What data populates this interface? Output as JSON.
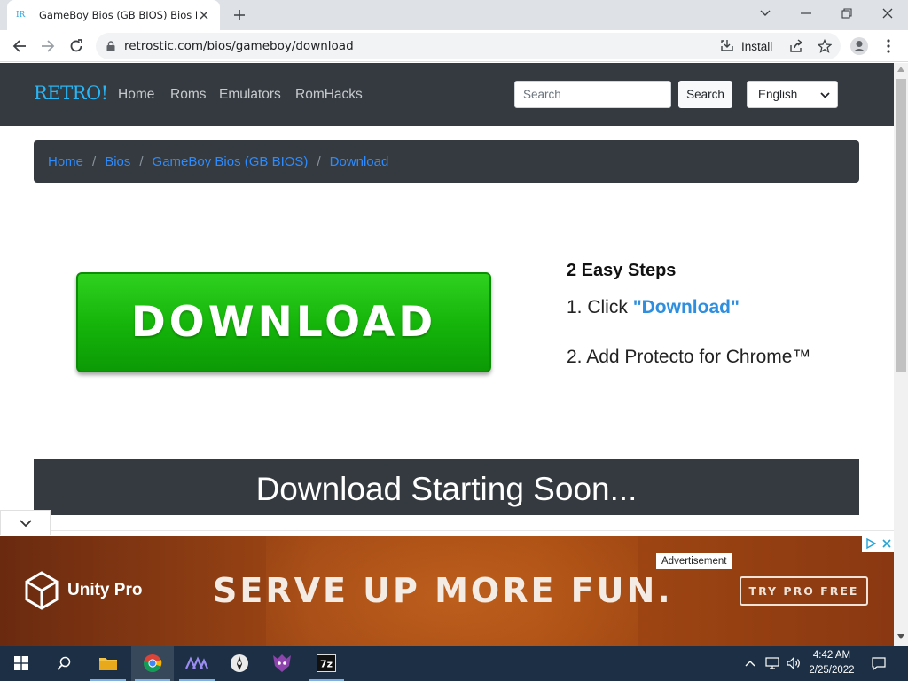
{
  "browser": {
    "tab_title": "GameBoy Bios (GB BIOS) Bios Do",
    "url": "retrostic.com/bios/gameboy/download",
    "install_label": "Install"
  },
  "site": {
    "brand": "RETRO!",
    "nav": [
      "Home",
      "Roms",
      "Emulators",
      "RomHacks"
    ],
    "search_placeholder": "Search",
    "search_button": "Search",
    "language": "English"
  },
  "breadcrumb": {
    "items": [
      "Home",
      "Bios",
      "GameBoy Bios (GB BIOS)",
      "Download"
    ],
    "separator": "/"
  },
  "download": {
    "button_label": "DOWNLOAD",
    "steps_title": "2 Easy Steps",
    "step1_prefix": "1. Click ",
    "step1_link": "\"Download\"",
    "step2": "2. Add Protecto for Chrome™",
    "status": "Download Starting Soon..."
  },
  "ad": {
    "label": "Advertisement",
    "brand": "Unity Pro",
    "headline": "SERVE UP MORE FUN.",
    "cta": "TRY PRO FREE"
  },
  "taskbar": {
    "time": "4:42 AM",
    "date": "2/25/2022",
    "apps": [
      "start-icon",
      "search-icon",
      "file-explorer-icon",
      "chrome-icon",
      "app-icon",
      "app-icon",
      "app-icon",
      "7zip-icon"
    ]
  },
  "colors": {
    "nav_bg": "#343a40",
    "link": "#2e8bfd",
    "download_green": "#14b30a",
    "taskbar_bg": "#1c2f45"
  }
}
